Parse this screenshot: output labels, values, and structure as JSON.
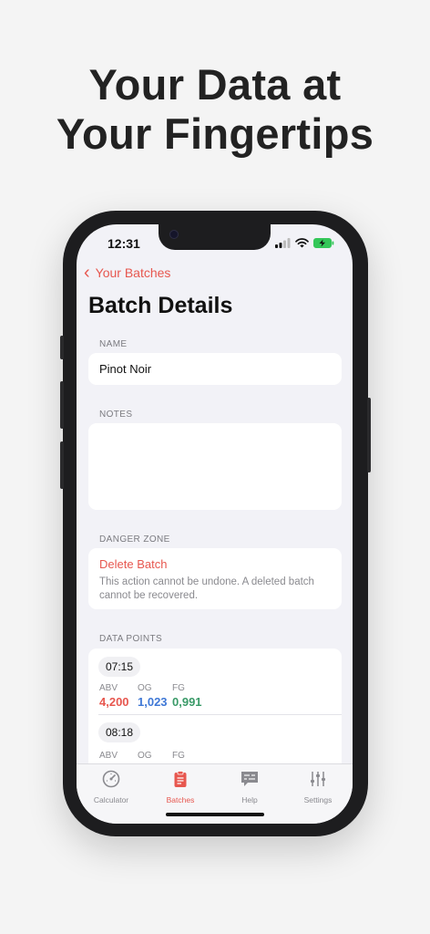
{
  "headline": {
    "line1": "Your Data at",
    "line2": "Your Fingertips"
  },
  "status_bar": {
    "time": "12:31"
  },
  "nav": {
    "back_label": "Your Batches",
    "title": "Batch Details"
  },
  "name_section": {
    "label": "NAME",
    "value": "Pinot Noir"
  },
  "notes_section": {
    "label": "NOTES",
    "value": ""
  },
  "danger_section": {
    "label": "DANGER ZONE",
    "delete_label": "Delete Batch",
    "note": "This action cannot be undone. A deleted batch cannot be recovered."
  },
  "data_points": {
    "label": "DATA POINTS",
    "column_labels": {
      "abv": "ABV",
      "og": "OG",
      "fg": "FG"
    },
    "items": [
      {
        "time": "07:15",
        "abv": "4,200",
        "og": "1,023",
        "fg": "0,991"
      },
      {
        "time": "08:18",
        "abv": "",
        "og": "",
        "fg": ""
      }
    ]
  },
  "tabbar": {
    "items": [
      {
        "label": "Calculator",
        "icon": "gauge-icon",
        "active": false
      },
      {
        "label": "Batches",
        "icon": "clipboard-icon",
        "active": true
      },
      {
        "label": "Help",
        "icon": "chat-bubble-icon",
        "active": false
      },
      {
        "label": "Settings",
        "icon": "sliders-icon",
        "active": false
      }
    ]
  },
  "colors": {
    "accent": "#e7574f",
    "abv": "#e7574f",
    "og": "#3f78d6",
    "fg": "#3a9a68",
    "inactive_tab": "#8a8a8f"
  }
}
